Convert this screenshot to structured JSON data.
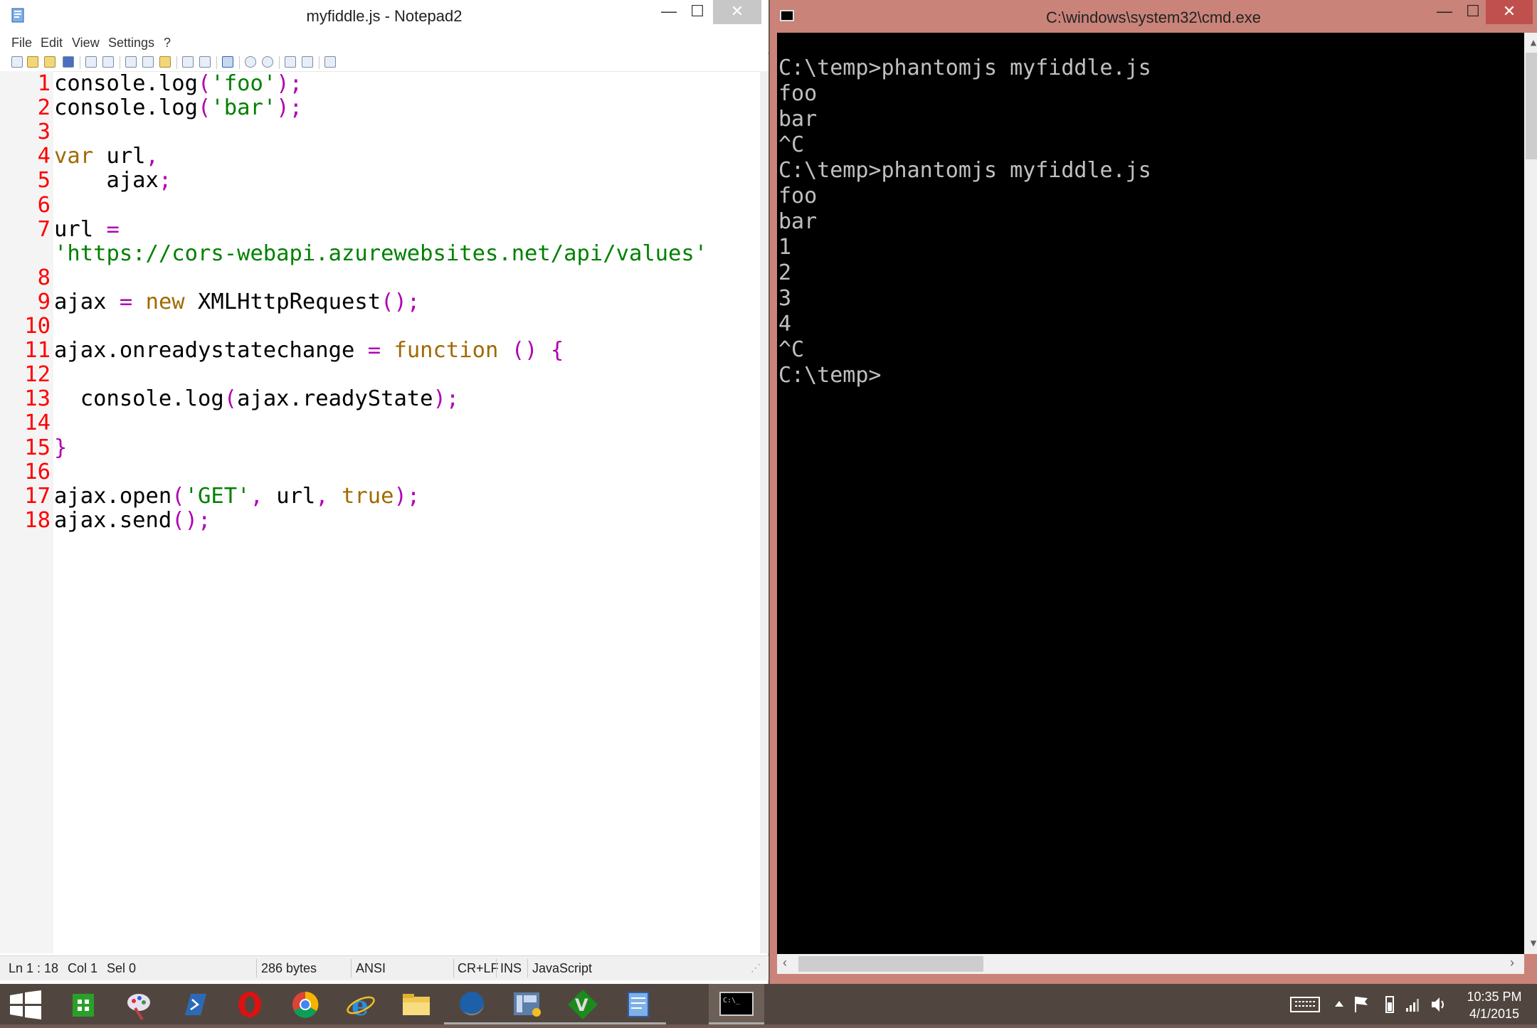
{
  "notepad": {
    "title": "myfiddle.js - Notepad2",
    "caption": {
      "minimize": "—",
      "maximize": "☐",
      "close": "✕"
    },
    "menu": [
      "File",
      "Edit",
      "View",
      "Settings",
      "?"
    ],
    "code_lines": [
      {
        "n": "1",
        "tokens": [
          [
            "",
            "console.log"
          ],
          [
            "op",
            "("
          ],
          [
            "str",
            "'foo'"
          ],
          [
            "op",
            ");"
          ]
        ]
      },
      {
        "n": "2",
        "tokens": [
          [
            "",
            "console.log"
          ],
          [
            "op",
            "("
          ],
          [
            "str",
            "'bar'"
          ],
          [
            "op",
            ");"
          ]
        ]
      },
      {
        "n": "3",
        "tokens": []
      },
      {
        "n": "4",
        "tokens": [
          [
            "kw",
            "var"
          ],
          [
            "",
            " url"
          ],
          [
            "op",
            ","
          ]
        ]
      },
      {
        "n": "5",
        "tokens": [
          [
            "",
            "    ajax"
          ],
          [
            "op",
            ";"
          ]
        ]
      },
      {
        "n": "6",
        "tokens": []
      },
      {
        "n": "7",
        "tokens": [
          [
            "",
            "url "
          ],
          [
            "op",
            "="
          ]
        ]
      },
      {
        "n": "",
        "tokens": [
          [
            "str",
            "'https://cors-webapi.azurewebsites.net/api/values'"
          ]
        ]
      },
      {
        "n": "8",
        "tokens": []
      },
      {
        "n": "9",
        "tokens": [
          [
            "",
            "ajax "
          ],
          [
            "op",
            "="
          ],
          [
            "",
            " "
          ],
          [
            "kw",
            "new"
          ],
          [
            "",
            " XMLHttpRequest"
          ],
          [
            "op",
            "();"
          ]
        ]
      },
      {
        "n": "10",
        "tokens": []
      },
      {
        "n": "11",
        "tokens": [
          [
            "",
            "ajax.onreadystatechange "
          ],
          [
            "op",
            "="
          ],
          [
            "",
            " "
          ],
          [
            "kw",
            "function"
          ],
          [
            "",
            " "
          ],
          [
            "op",
            "()"
          ],
          [
            "",
            " "
          ],
          [
            "op",
            "{"
          ]
        ]
      },
      {
        "n": "12",
        "tokens": []
      },
      {
        "n": "13",
        "tokens": [
          [
            "",
            "  console.log"
          ],
          [
            "op",
            "("
          ],
          [
            "",
            "ajax.readyState"
          ],
          [
            "op",
            ");"
          ]
        ]
      },
      {
        "n": "14",
        "tokens": []
      },
      {
        "n": "15",
        "tokens": [
          [
            "op",
            "}"
          ]
        ]
      },
      {
        "n": "16",
        "tokens": []
      },
      {
        "n": "17",
        "tokens": [
          [
            "",
            "ajax.open"
          ],
          [
            "op",
            "("
          ],
          [
            "str",
            "'GET'"
          ],
          [
            "op",
            ","
          ],
          [
            "",
            " url"
          ],
          [
            "op",
            ","
          ],
          [
            "",
            " "
          ],
          [
            "kw",
            "true"
          ],
          [
            "op",
            ");"
          ]
        ]
      },
      {
        "n": "18",
        "tokens": [
          [
            "",
            "ajax.send"
          ],
          [
            "op",
            "();"
          ]
        ]
      }
    ],
    "status": {
      "position": "Ln 1 : 18",
      "col": "Col 1",
      "sel": "Sel 0",
      "size": "286 bytes",
      "encoding": "ANSI",
      "eol": "CR+LF",
      "mode": "INS",
      "lexer": "JavaScript"
    }
  },
  "cmd": {
    "title": "C:\\windows\\system32\\cmd.exe",
    "caption": {
      "minimize": "—",
      "maximize": "☐",
      "close": "✕"
    },
    "lines": [
      "",
      "C:\\temp>phantomjs myfiddle.js",
      "foo",
      "bar",
      "^C",
      "C:\\temp>phantomjs myfiddle.js",
      "foo",
      "bar",
      "1",
      "2",
      "3",
      "4",
      "^C",
      "C:\\temp>"
    ]
  },
  "taskbar": {
    "apps": [
      {
        "name": "start-icon"
      },
      {
        "name": "store-icon"
      },
      {
        "name": "paint-icon"
      },
      {
        "name": "powershell-icon"
      },
      {
        "name": "opera-icon"
      },
      {
        "name": "chrome-icon"
      },
      {
        "name": "internet-explorer-icon"
      },
      {
        "name": "file-explorer-icon"
      },
      {
        "name": "firefox-icon"
      },
      {
        "name": "visual-studio-icon"
      },
      {
        "name": "vim-icon"
      },
      {
        "name": "notepad2-icon"
      },
      {
        "name": "cmd-icon"
      }
    ],
    "clock_time": "10:35 PM",
    "clock_date": "4/1/2015",
    "colors": {
      "background": "#51463f",
      "cmd_frame": "#c98378",
      "close_red": "#c0504d"
    }
  }
}
